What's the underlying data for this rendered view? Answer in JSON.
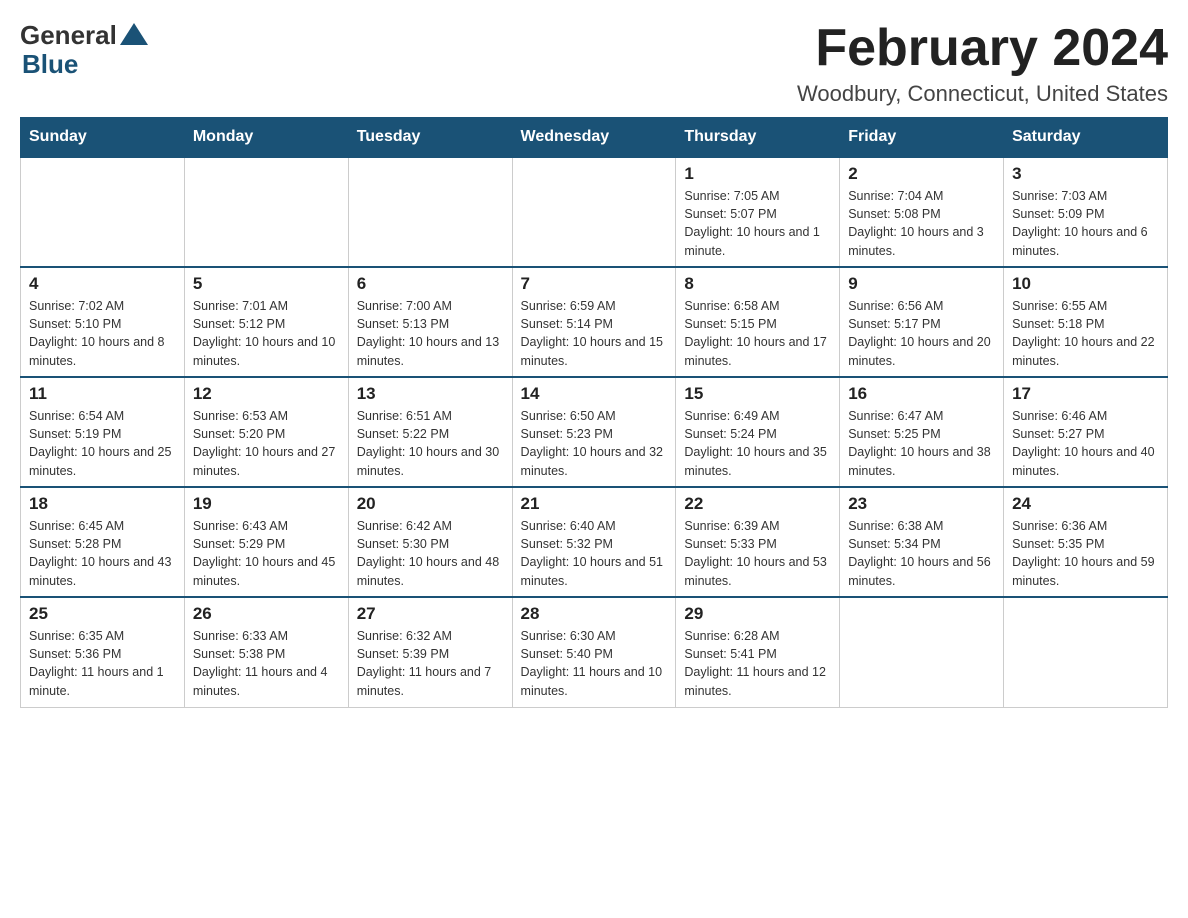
{
  "header": {
    "month_title": "February 2024",
    "location": "Woodbury, Connecticut, United States",
    "logo_general": "General",
    "logo_blue": "Blue"
  },
  "days_of_week": [
    "Sunday",
    "Monday",
    "Tuesday",
    "Wednesday",
    "Thursday",
    "Friday",
    "Saturday"
  ],
  "weeks": [
    [
      {
        "day": "",
        "info": ""
      },
      {
        "day": "",
        "info": ""
      },
      {
        "day": "",
        "info": ""
      },
      {
        "day": "",
        "info": ""
      },
      {
        "day": "1",
        "info": "Sunrise: 7:05 AM\nSunset: 5:07 PM\nDaylight: 10 hours and 1 minute."
      },
      {
        "day": "2",
        "info": "Sunrise: 7:04 AM\nSunset: 5:08 PM\nDaylight: 10 hours and 3 minutes."
      },
      {
        "day": "3",
        "info": "Sunrise: 7:03 AM\nSunset: 5:09 PM\nDaylight: 10 hours and 6 minutes."
      }
    ],
    [
      {
        "day": "4",
        "info": "Sunrise: 7:02 AM\nSunset: 5:10 PM\nDaylight: 10 hours and 8 minutes."
      },
      {
        "day": "5",
        "info": "Sunrise: 7:01 AM\nSunset: 5:12 PM\nDaylight: 10 hours and 10 minutes."
      },
      {
        "day": "6",
        "info": "Sunrise: 7:00 AM\nSunset: 5:13 PM\nDaylight: 10 hours and 13 minutes."
      },
      {
        "day": "7",
        "info": "Sunrise: 6:59 AM\nSunset: 5:14 PM\nDaylight: 10 hours and 15 minutes."
      },
      {
        "day": "8",
        "info": "Sunrise: 6:58 AM\nSunset: 5:15 PM\nDaylight: 10 hours and 17 minutes."
      },
      {
        "day": "9",
        "info": "Sunrise: 6:56 AM\nSunset: 5:17 PM\nDaylight: 10 hours and 20 minutes."
      },
      {
        "day": "10",
        "info": "Sunrise: 6:55 AM\nSunset: 5:18 PM\nDaylight: 10 hours and 22 minutes."
      }
    ],
    [
      {
        "day": "11",
        "info": "Sunrise: 6:54 AM\nSunset: 5:19 PM\nDaylight: 10 hours and 25 minutes."
      },
      {
        "day": "12",
        "info": "Sunrise: 6:53 AM\nSunset: 5:20 PM\nDaylight: 10 hours and 27 minutes."
      },
      {
        "day": "13",
        "info": "Sunrise: 6:51 AM\nSunset: 5:22 PM\nDaylight: 10 hours and 30 minutes."
      },
      {
        "day": "14",
        "info": "Sunrise: 6:50 AM\nSunset: 5:23 PM\nDaylight: 10 hours and 32 minutes."
      },
      {
        "day": "15",
        "info": "Sunrise: 6:49 AM\nSunset: 5:24 PM\nDaylight: 10 hours and 35 minutes."
      },
      {
        "day": "16",
        "info": "Sunrise: 6:47 AM\nSunset: 5:25 PM\nDaylight: 10 hours and 38 minutes."
      },
      {
        "day": "17",
        "info": "Sunrise: 6:46 AM\nSunset: 5:27 PM\nDaylight: 10 hours and 40 minutes."
      }
    ],
    [
      {
        "day": "18",
        "info": "Sunrise: 6:45 AM\nSunset: 5:28 PM\nDaylight: 10 hours and 43 minutes."
      },
      {
        "day": "19",
        "info": "Sunrise: 6:43 AM\nSunset: 5:29 PM\nDaylight: 10 hours and 45 minutes."
      },
      {
        "day": "20",
        "info": "Sunrise: 6:42 AM\nSunset: 5:30 PM\nDaylight: 10 hours and 48 minutes."
      },
      {
        "day": "21",
        "info": "Sunrise: 6:40 AM\nSunset: 5:32 PM\nDaylight: 10 hours and 51 minutes."
      },
      {
        "day": "22",
        "info": "Sunrise: 6:39 AM\nSunset: 5:33 PM\nDaylight: 10 hours and 53 minutes."
      },
      {
        "day": "23",
        "info": "Sunrise: 6:38 AM\nSunset: 5:34 PM\nDaylight: 10 hours and 56 minutes."
      },
      {
        "day": "24",
        "info": "Sunrise: 6:36 AM\nSunset: 5:35 PM\nDaylight: 10 hours and 59 minutes."
      }
    ],
    [
      {
        "day": "25",
        "info": "Sunrise: 6:35 AM\nSunset: 5:36 PM\nDaylight: 11 hours and 1 minute."
      },
      {
        "day": "26",
        "info": "Sunrise: 6:33 AM\nSunset: 5:38 PM\nDaylight: 11 hours and 4 minutes."
      },
      {
        "day": "27",
        "info": "Sunrise: 6:32 AM\nSunset: 5:39 PM\nDaylight: 11 hours and 7 minutes."
      },
      {
        "day": "28",
        "info": "Sunrise: 6:30 AM\nSunset: 5:40 PM\nDaylight: 11 hours and 10 minutes."
      },
      {
        "day": "29",
        "info": "Sunrise: 6:28 AM\nSunset: 5:41 PM\nDaylight: 11 hours and 12 minutes."
      },
      {
        "day": "",
        "info": ""
      },
      {
        "day": "",
        "info": ""
      }
    ]
  ]
}
